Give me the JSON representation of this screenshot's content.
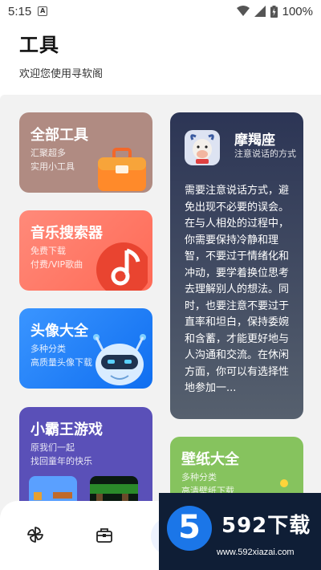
{
  "status": {
    "time": "5:15",
    "battery": "100%"
  },
  "header": {
    "title": "工具",
    "subtitle": "欢迎您使用寻软阁"
  },
  "cards": {
    "tools": {
      "title": "全部工具",
      "sub": "汇聚超多\n实用小工具"
    },
    "music": {
      "title": "音乐搜索器",
      "sub": "免费下载\n付费/VIP歌曲"
    },
    "avatar": {
      "title": "头像大全",
      "sub": "多种分类\n高质量头像下载"
    },
    "game": {
      "title": "小霸王游戏",
      "sub": "原我们一起\n找回童年的快乐"
    },
    "wallpaper": {
      "title": "壁纸大全",
      "sub": "多种分类\n高清壁纸下载"
    },
    "zodiac": {
      "title": "摩羯座",
      "sub": "注意说话的方式",
      "body": "需要注意说话方式，避免出现不必要的误会。在与人相处的过程中，你需要保持冷静和理智，不要过于情绪化和冲动，要学着换位思考去理解别人的想法。同时，也要注意不要过于直率和坦白，保持委婉和含蓄，才能更好地与人沟通和交流。在休闲方面，你可以有选择性地参加一..."
    }
  },
  "watermark": {
    "brand": "592下载",
    "url": "www.592xiazai.com",
    "logo_digit": "5"
  },
  "colors": {
    "tools": "#b08b82",
    "music": "#ff7a66",
    "avatar": "#2584f8",
    "game": "#5a50b8",
    "wallpaper": "#86c35e",
    "zodiac": "#2c3555"
  }
}
